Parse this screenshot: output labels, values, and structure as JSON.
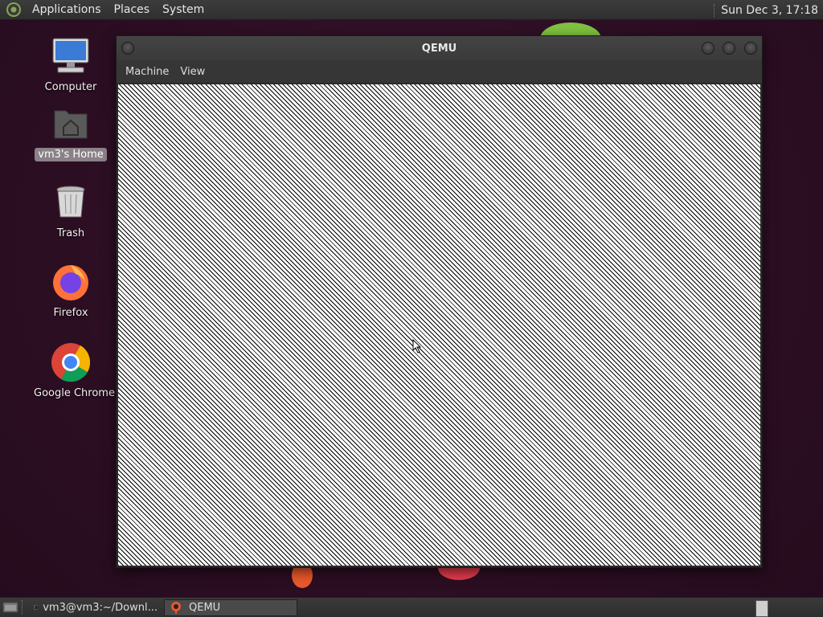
{
  "top_panel": {
    "menus": [
      "Applications",
      "Places",
      "System"
    ],
    "clock": "Sun Dec 3, 17:18"
  },
  "desktop": {
    "icons": [
      {
        "label": "Computer",
        "icon": "computer-icon"
      },
      {
        "label": "vm3's Home",
        "icon": "home-folder-icon",
        "selected": true
      },
      {
        "label": "Trash",
        "icon": "trash-icon"
      },
      {
        "label": "Firefox",
        "icon": "firefox-icon"
      },
      {
        "label": "Google Chrome",
        "icon": "chrome-icon"
      }
    ]
  },
  "qemu_window": {
    "title": "QEMU",
    "menu": [
      "Machine",
      "View"
    ]
  },
  "taskbar": {
    "items": [
      {
        "label": "vm3@vm3:~/Downl...",
        "icon": "terminal-icon"
      },
      {
        "label": "QEMU",
        "icon": "qemu-icon",
        "active": true
      }
    ]
  },
  "colors": {
    "panel": "#333333",
    "wallpaper": "#2c0e22",
    "selection": "#aaaaaa"
  }
}
